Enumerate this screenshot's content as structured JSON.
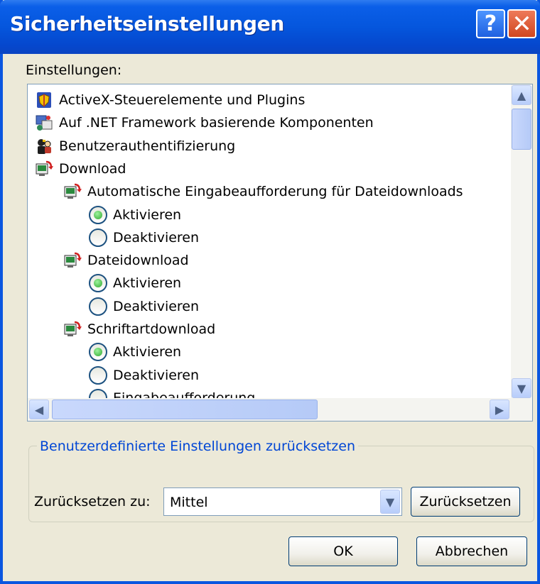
{
  "window": {
    "title": "Sicherheitseinstellungen",
    "help_glyph": "?",
    "close_glyph": "✕",
    "accent": "#0a56e0"
  },
  "settings": {
    "label": "Einstellungen:",
    "items": [
      {
        "type": "category",
        "label": "ActiveX-Steuerelemente und Plugins",
        "icon": "activex-shield-icon"
      },
      {
        "type": "category",
        "label": "Auf .NET Framework basierende Komponenten",
        "icon": "dotnet-components-icon"
      },
      {
        "type": "category",
        "label": "Benutzerauthentifizierung",
        "icon": "user-authentication-icon"
      },
      {
        "type": "category",
        "label": "Download",
        "icon": "download-icon"
      },
      {
        "type": "setting",
        "label": "Automatische Eingabeaufforderung für Dateidownloads",
        "icon": "download-icon"
      },
      {
        "type": "option",
        "label": "Aktivieren",
        "checked": true
      },
      {
        "type": "option",
        "label": "Deaktivieren",
        "checked": false
      },
      {
        "type": "setting",
        "label": "Dateidownload",
        "icon": "download-icon"
      },
      {
        "type": "option",
        "label": "Aktivieren",
        "checked": true
      },
      {
        "type": "option",
        "label": "Deaktivieren",
        "checked": false
      },
      {
        "type": "setting",
        "label": "Schriftartdownload",
        "icon": "download-icon"
      },
      {
        "type": "option",
        "label": "Aktivieren",
        "checked": true
      },
      {
        "type": "option",
        "label": "Deaktivieren",
        "checked": false
      },
      {
        "type": "option",
        "label": "Eingabeaufforderung",
        "checked": false
      }
    ]
  },
  "reset_group": {
    "legend": "Benutzerdefinierte Einstellungen zurücksetzen",
    "reset_to_label": "Zurücksetzen zu:",
    "selected_value": "Mittel",
    "reset_button": "Zurücksetzen"
  },
  "footer": {
    "ok": "OK",
    "cancel": "Abbrechen"
  }
}
